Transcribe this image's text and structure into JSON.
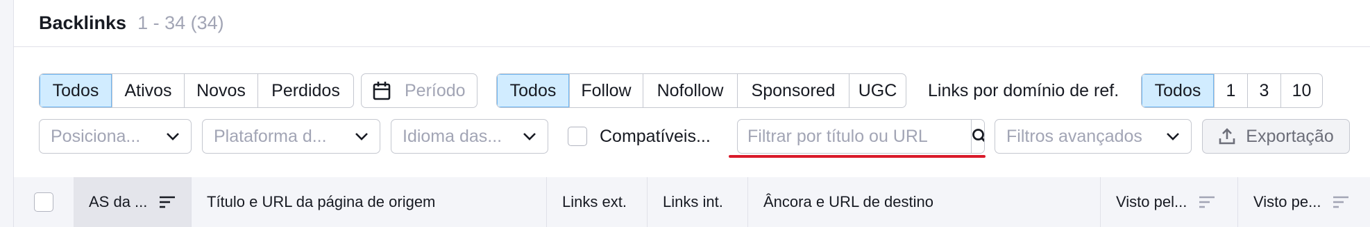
{
  "header": {
    "title": "Backlinks",
    "count": "1 - 34 (34)"
  },
  "status_filter": {
    "options": [
      "Todos",
      "Ativos",
      "Novos",
      "Perdidos"
    ],
    "active": 0
  },
  "period": {
    "label": "Período",
    "icon": "calendar-icon"
  },
  "type_filter": {
    "options": [
      "Todos",
      "Follow",
      "Nofollow",
      "Sponsored",
      "UGC"
    ],
    "active": 0
  },
  "links_per_domain": {
    "label": "Links por domínio de ref.",
    "options": [
      "Todos",
      "1",
      "3",
      "10"
    ],
    "active": 0
  },
  "dropdowns": {
    "position": "Posiciona...",
    "platform": "Plataforma d...",
    "language": "Idioma das..."
  },
  "compatible": {
    "label": "Compatíveis..."
  },
  "search": {
    "placeholder": "Filtrar por título ou URL",
    "icon": "search-icon"
  },
  "advanced": {
    "label": "Filtros avançados"
  },
  "export": {
    "label": "Exportação",
    "icon": "upload-icon"
  },
  "colors": {
    "active_bg": "#d1ecff",
    "active_border": "#6fb6f2",
    "underline": "#d91a2a"
  },
  "table": {
    "columns": [
      "AS da ...",
      "Título e URL da página de origem",
      "Links ext.",
      "Links int.",
      "Âncora e URL de destino",
      "Visto pel...",
      "Visto pe..."
    ]
  }
}
